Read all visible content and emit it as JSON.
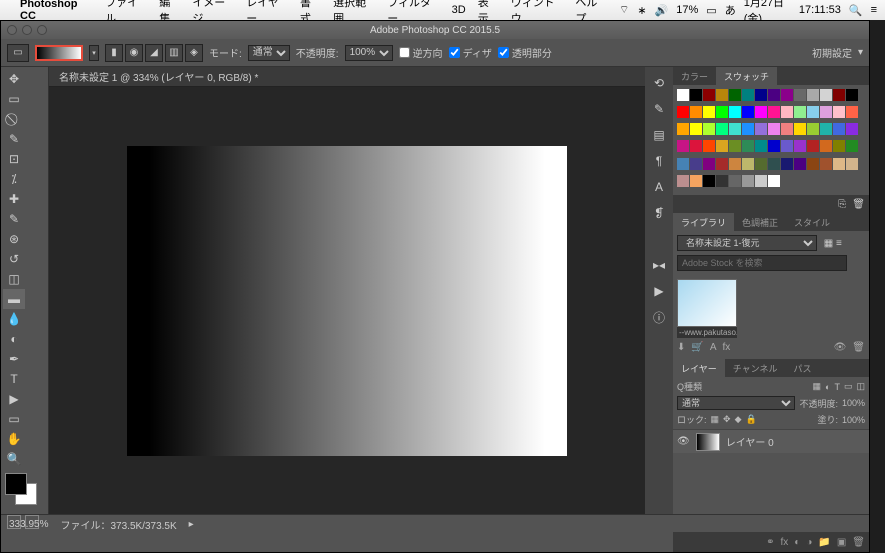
{
  "menubar": {
    "app": "Photoshop CC",
    "items": [
      "ファイル",
      "編集",
      "イメージ",
      "レイヤー",
      "書式",
      "選択範囲",
      "フィルター",
      "3D",
      "表示",
      "ウィンドウ",
      "ヘルプ"
    ],
    "battery": "17%",
    "date": "1月27日(金)",
    "time": "17:11:53"
  },
  "window": {
    "title": "Adobe Photoshop CC 2015.5"
  },
  "optbar": {
    "mode_label": "モード:",
    "mode_value": "通常",
    "opacity_label": "不透明度:",
    "opacity_value": "100%",
    "reverse": "逆方向",
    "dither": "ディザ",
    "transparent": "透明部分",
    "preset": "初期設定"
  },
  "doc": {
    "tab": "名称未設定 1 @ 334% (レイヤー 0, RGB/8) *"
  },
  "panels": {
    "color_tab": "カラー",
    "swatch_tab": "スウォッチ",
    "library_tab": "ライブラリ",
    "cc_tab": "色調補正",
    "style_tab": "スタイル",
    "library_doc": "名称未設定 1-復元",
    "search_ph": "Adobe Stock を検索",
    "thumb_caption": "--www.pakutaso....",
    "layers_tab": "レイヤー",
    "channels_tab": "チャンネル",
    "paths_tab": "パス",
    "kind_label": "Q種類",
    "blend": "通常",
    "opacity_l": "不透明度:",
    "opacity_v": "100%",
    "lock_label": "ロック:",
    "fill_label": "塗り:",
    "fill_v": "100%",
    "layer0": "レイヤー 0"
  },
  "status": {
    "zoom": "333.95%",
    "file": "ファイル：373.5K/373.5K"
  },
  "swatch_colors": [
    "#fff",
    "#000",
    "#8b0000",
    "#b8860b",
    "#006400",
    "#008080",
    "#00008b",
    "#4b0082",
    "#8b008b",
    "#696969",
    "#a9a9a9",
    "#d3d3d3",
    "#800000",
    "#000",
    "#f00",
    "#ff8c00",
    "#ff0",
    "#0f0",
    "#0ff",
    "#00f",
    "#f0f",
    "#ff1493",
    "#ffb6c1",
    "#90ee90",
    "#87ceeb",
    "#dda0dd",
    "#ffc0cb",
    "#ff6347",
    "#ffa500",
    "#ffff00",
    "#adff2f",
    "#00ff7f",
    "#40e0d0",
    "#1e90ff",
    "#9370db",
    "#ee82ee",
    "#f08080",
    "#ffd700",
    "#9acd32",
    "#20b2aa",
    "#4169e1",
    "#8a2be2",
    "#c71585",
    "#dc143c",
    "#ff4500",
    "#daa520",
    "#6b8e23",
    "#2e8b57",
    "#008b8b",
    "#0000cd",
    "#6a5acd",
    "#9932cc",
    "#b22222",
    "#d2691e",
    "#808000",
    "#228b22",
    "#4682b4",
    "#483d8b",
    "#800080",
    "#a52a2a",
    "#cd853f",
    "#bdb76b",
    "#556b2f",
    "#2f4f4f",
    "#191970",
    "#4b0082",
    "#8b4513",
    "#a0522d",
    "#deb887",
    "#d2b48c",
    "#bc8f8f",
    "#f4a460",
    "#000",
    "#333",
    "#666",
    "#999",
    "#ccc",
    "#fff"
  ]
}
